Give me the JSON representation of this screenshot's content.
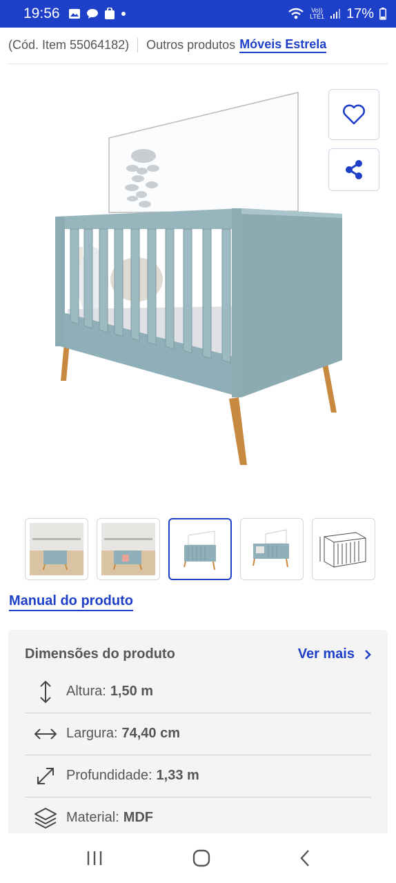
{
  "status_bar": {
    "time": "19:56",
    "net_label_top": "Vo))",
    "net_label_bottom": "LTE1",
    "battery": "17%"
  },
  "item": {
    "code": "(Cód. Item 55064182)",
    "other_label": "Outros produtos",
    "brand": "Móveis Estrela"
  },
  "actions": {
    "favorite_icon": "heart-icon",
    "share_icon": "share-icon"
  },
  "gallery": {
    "thumbnails": [
      "room-photo-1",
      "room-photo-2",
      "crib-product",
      "crib-with-changer",
      "crib-dimension-drawing"
    ],
    "active_index": 2
  },
  "manual_link": "Manual do produto",
  "dimensions": {
    "title": "Dimensões do produto",
    "see_more": "Ver mais",
    "rows": [
      {
        "icon": "vertical-arrows-icon",
        "label": "Altura:",
        "value": "1,50 m"
      },
      {
        "icon": "horizontal-arrows-icon",
        "label": "Largura:",
        "value": "74,40 cm"
      },
      {
        "icon": "diagonal-arrows-icon",
        "label": "Profundidade:",
        "value": "1,33 m"
      },
      {
        "icon": "layers-icon",
        "label": "Material:",
        "value": "MDF"
      }
    ]
  },
  "colors": {
    "accent": "#1e40c8",
    "crib": "#8fb0b8",
    "legs": "#c7883f"
  }
}
